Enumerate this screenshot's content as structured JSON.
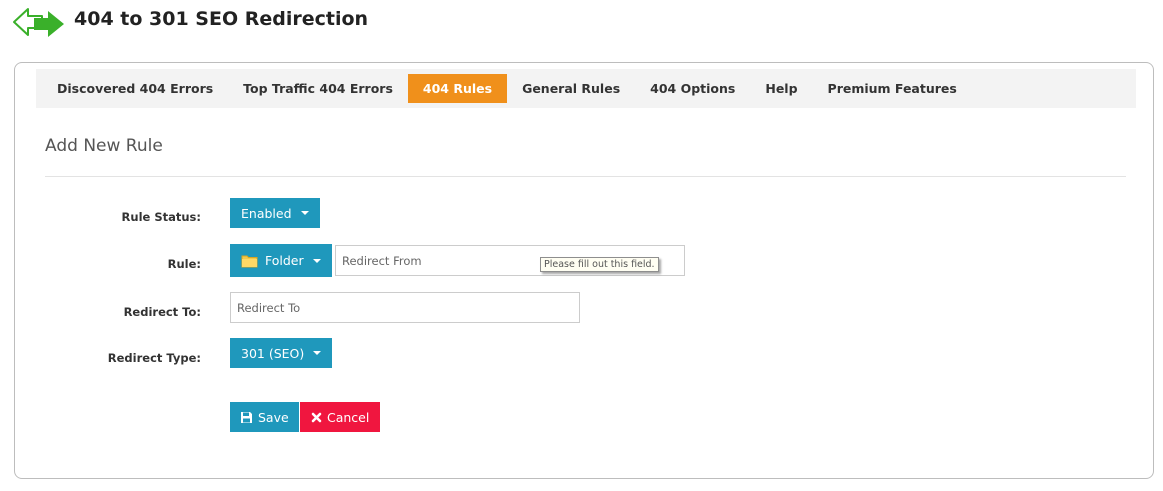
{
  "header": {
    "title": "404 to 301 SEO Redirection",
    "logo_icon": "double-arrow-icon"
  },
  "tabs": [
    {
      "label": "Discovered 404 Errors"
    },
    {
      "label": "Top Traffic 404 Errors"
    },
    {
      "label": "404 Rules",
      "active": true
    },
    {
      "label": "General Rules"
    },
    {
      "label": "404 Options"
    },
    {
      "label": "Help"
    },
    {
      "label": "Premium Features"
    }
  ],
  "section": {
    "title": "Add New Rule"
  },
  "form": {
    "rule_status": {
      "label": "Rule Status:",
      "value": "Enabled"
    },
    "rule": {
      "label": "Rule:",
      "type_value": "Folder",
      "type_icon": "folder-icon",
      "from_placeholder": "Redirect From",
      "tooltip": "Please fill out this field."
    },
    "redirect_to": {
      "label": "Redirect To:",
      "placeholder": "Redirect To"
    },
    "redirect_type": {
      "label": "Redirect Type:",
      "value": "301 (SEO)"
    },
    "save": {
      "label": "Save",
      "icon": "floppy-disk-icon"
    },
    "cancel": {
      "label": "Cancel",
      "icon": "close-icon"
    }
  },
  "colors": {
    "primary": "#1f98bc",
    "active_tab": "#f0901b",
    "danger": "#f0163f",
    "logo_green": "#3ab02a"
  }
}
